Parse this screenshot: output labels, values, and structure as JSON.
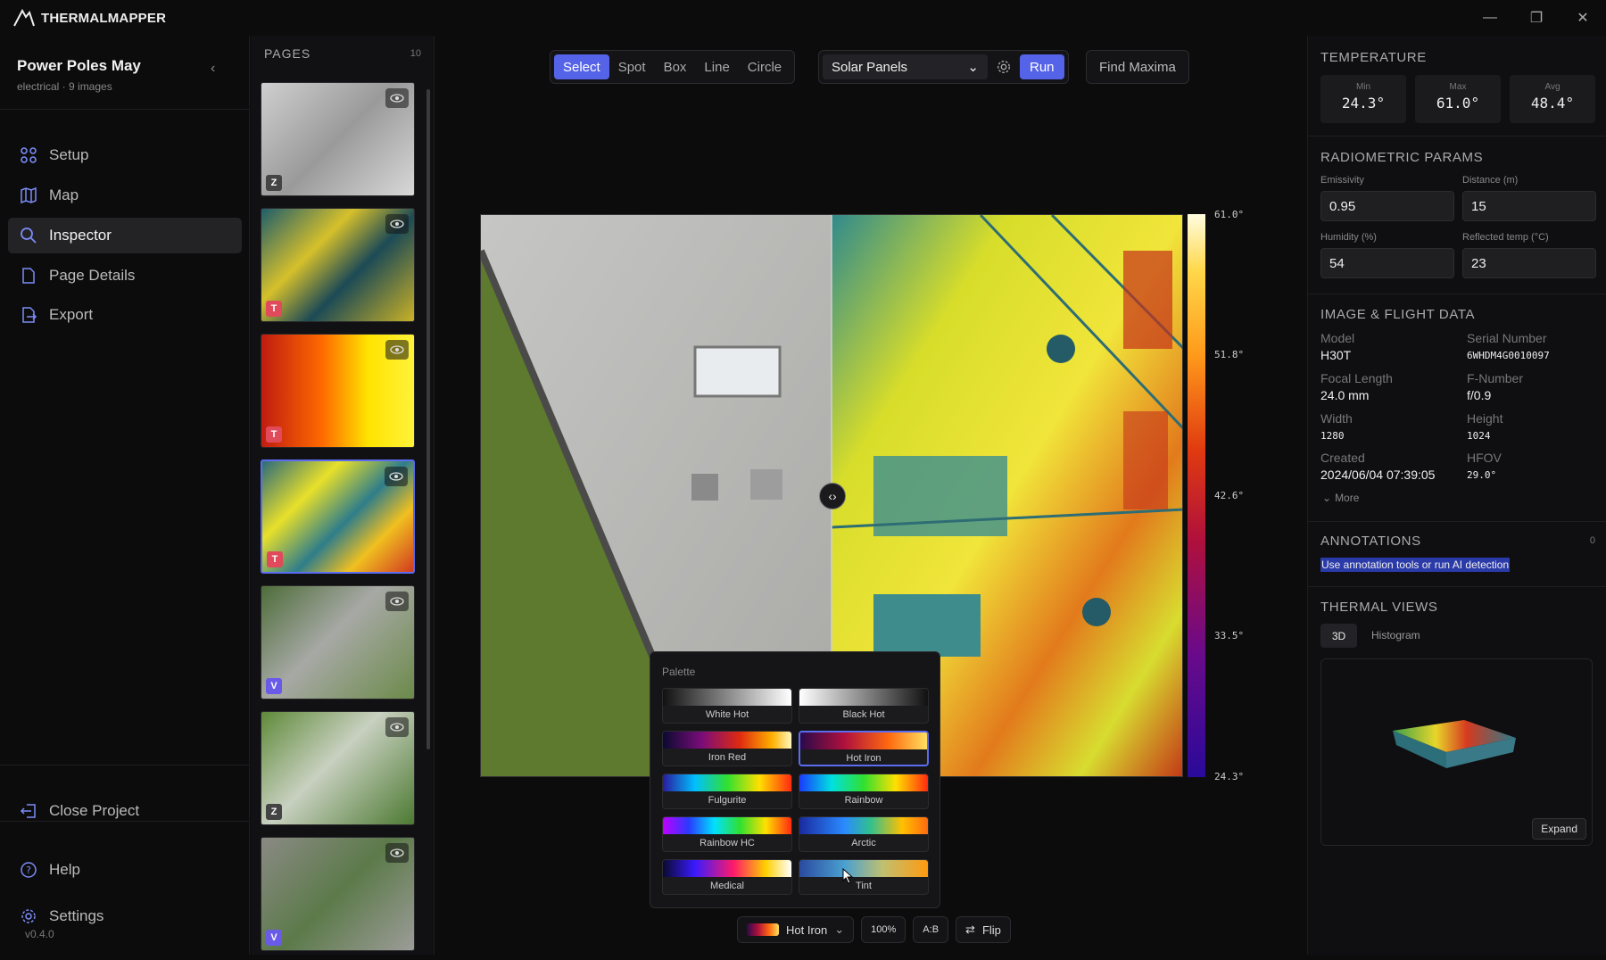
{
  "app": {
    "title": "THERMALMAPPER",
    "version": "v0.4.0"
  },
  "window_controls": [
    "minimize-icon",
    "maximize-icon",
    "close-icon"
  ],
  "project": {
    "title": "Power Poles May",
    "subtitle": "electrical · 9 images"
  },
  "nav": {
    "setup": "Setup",
    "map": "Map",
    "inspector": "Inspector",
    "page_details": "Page Details",
    "export": "Export",
    "close_project": "Close Project",
    "help": "Help",
    "settings": "Settings"
  },
  "pages": {
    "heading": "PAGES",
    "count": "10",
    "badges": [
      "Z",
      "T",
      "T",
      "T",
      "V",
      "Z",
      "V"
    ]
  },
  "toolbar": {
    "tools": [
      "Select",
      "Spot",
      "Box",
      "Line",
      "Circle"
    ],
    "active_tool": "Select",
    "preset": "Solar Panels",
    "run": "Run",
    "find_maxima": "Find Maxima"
  },
  "colorbar": {
    "max": "61.0°",
    "t1": "51.8°",
    "t2": "42.6°",
    "t3": "33.5°",
    "min": "24.3°"
  },
  "palette": {
    "title": "Palette",
    "options": [
      "White Hot",
      "Black Hot",
      "Iron Red",
      "Hot Iron",
      "Fulgurite",
      "Rainbow",
      "Rainbow HC",
      "Arctic",
      "Medical",
      "Tint"
    ],
    "selected": "Hot Iron"
  },
  "bottom": {
    "palette": "Hot Iron",
    "zoom": "100%",
    "ab": "A:B",
    "flip": "Flip"
  },
  "temperature": {
    "heading": "TEMPERATURE",
    "min_label": "Min",
    "min": "24.3°",
    "max_label": "Max",
    "max": "61.0°",
    "avg_label": "Avg",
    "avg": "48.4°"
  },
  "radiometric": {
    "heading": "RADIOMETRIC PARAMS",
    "emissivity_label": "Emissivity",
    "emissivity": "0.95",
    "distance_label": "Distance (m)",
    "distance": "15",
    "humidity_label": "Humidity (%)",
    "humidity": "54",
    "reflected_label": "Reflected temp (°C)",
    "reflected": "23"
  },
  "flight": {
    "heading": "IMAGE & FLIGHT DATA",
    "model_label": "Model",
    "model": "H30T",
    "serial_label": "Serial Number",
    "serial": "6WHDM4G0010097",
    "focal_label": "Focal Length",
    "focal": "24.0 mm",
    "fnum_label": "F-Number",
    "fnum": "f/0.9",
    "width_label": "Width",
    "width": "1280",
    "height_label": "Height",
    "height": "1024",
    "created_label": "Created",
    "created": "2024/06/04 07:39:05",
    "hfov_label": "HFOV",
    "hfov": "29.0°",
    "more": "More"
  },
  "annotations": {
    "heading": "ANNOTATIONS",
    "count": "0",
    "hint": "Use annotation tools or run AI detection"
  },
  "thermal_views": {
    "heading": "THERMAL VIEWS",
    "tab_3d": "3D",
    "tab_hist": "Histogram",
    "expand": "Expand"
  }
}
